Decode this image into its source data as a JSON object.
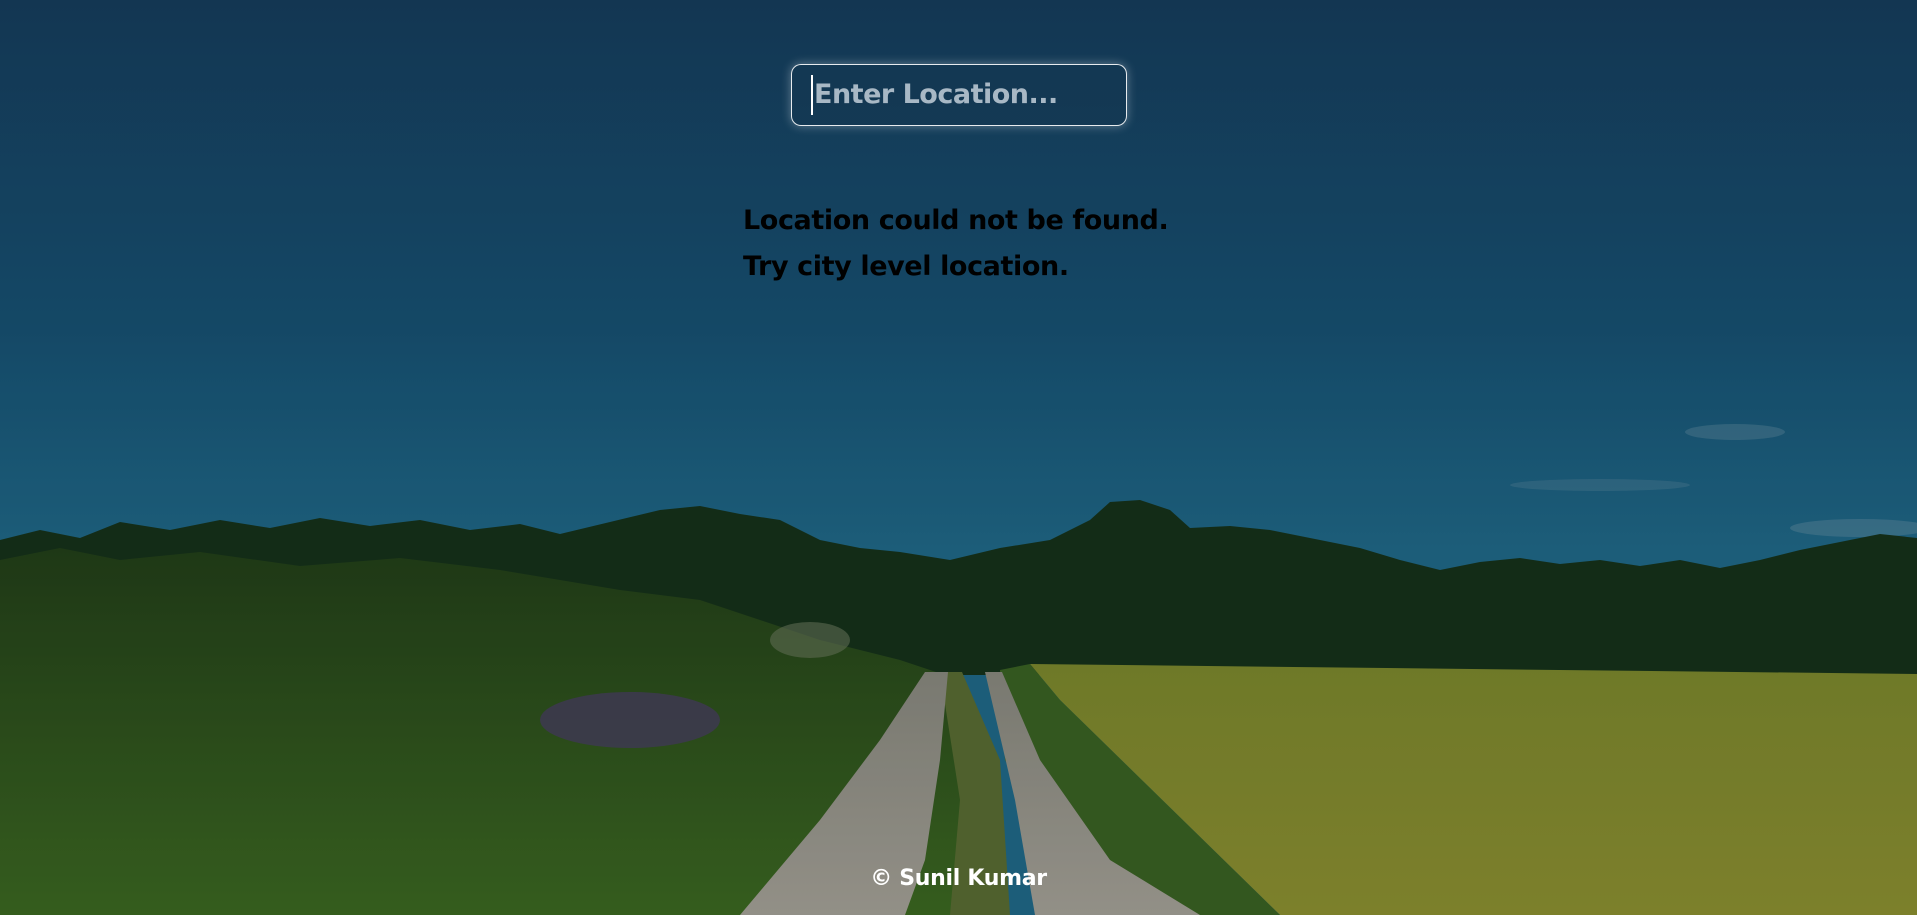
{
  "search": {
    "placeholder": "Enter Location...",
    "value": ""
  },
  "message": {
    "line1": "Location could not be found.",
    "line2": "Try city level location."
  },
  "footer": {
    "text": "© Sunil Kumar"
  },
  "colors": {
    "sky": "#175073",
    "message_text": "#000000",
    "footer_text": "#ffffff",
    "input_border": "#ffffff"
  }
}
